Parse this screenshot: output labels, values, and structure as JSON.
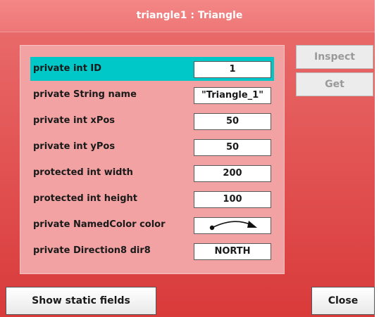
{
  "window": {
    "title": "triangle1 : Triangle"
  },
  "fields": [
    {
      "label": "private int ID",
      "value": "1",
      "selected": true
    },
    {
      "label": "private String name",
      "value": "\"Triangle_1\""
    },
    {
      "label": "private int xPos",
      "value": "50"
    },
    {
      "label": "private int yPos",
      "value": "50"
    },
    {
      "label": "protected int width",
      "value": "200"
    },
    {
      "label": "protected int height",
      "value": "100"
    },
    {
      "label": "private NamedColor color",
      "value_icon": "object-reference-arrow-icon"
    },
    {
      "label": "private Direction8 dir8",
      "value": "NORTH"
    }
  ],
  "side_buttons": {
    "inspect_label": "Inspect",
    "get_label": "Get"
  },
  "bottom_buttons": {
    "show_static_label": "Show static fields",
    "close_label": "Close"
  },
  "colors": {
    "selection": "#00c8c8",
    "window_bg": "#e35656",
    "panel_bg": "#f2a2a2"
  }
}
